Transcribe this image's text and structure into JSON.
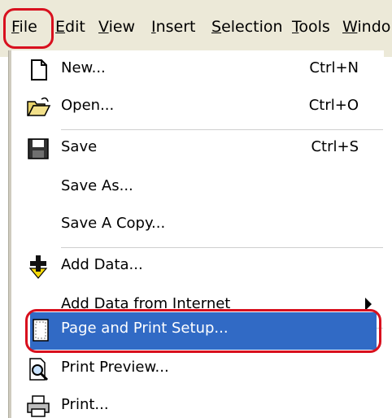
{
  "menubar": {
    "items": [
      {
        "label": "File",
        "mnemonic_index": 0
      },
      {
        "label": "Edit",
        "mnemonic_index": 0
      },
      {
        "label": "View",
        "mnemonic_index": 0
      },
      {
        "label": "Insert",
        "mnemonic_index": 0
      },
      {
        "label": "Selection",
        "mnemonic_index": 0
      },
      {
        "label": "Tools",
        "mnemonic_index": 0
      },
      {
        "label": "Windo",
        "mnemonic_index": 0
      }
    ]
  },
  "file_menu": {
    "items": [
      {
        "label": "New...",
        "shortcut": "Ctrl+N",
        "icon": "new-document-icon"
      },
      {
        "label": "Open...",
        "shortcut": "Ctrl+O",
        "icon": "open-folder-icon"
      },
      {
        "label": "Save",
        "shortcut": "Ctrl+S",
        "icon": "save-floppy-icon"
      },
      {
        "label": "Save As...",
        "shortcut": "",
        "icon": ""
      },
      {
        "label": "Save A Copy...",
        "shortcut": "",
        "icon": ""
      },
      {
        "label": "Add Data...",
        "shortcut": "",
        "icon": "add-data-icon"
      },
      {
        "label": "Add Data from Internet",
        "shortcut": "",
        "icon": "",
        "submenu": true
      },
      {
        "label": "Page and Print Setup...",
        "shortcut": "",
        "icon": "page-setup-icon",
        "selected": true
      },
      {
        "label": "Print Preview...",
        "shortcut": "",
        "icon": "print-preview-icon"
      },
      {
        "label": "Print...",
        "shortcut": "",
        "icon": "printer-icon"
      }
    ]
  },
  "colors": {
    "highlight": "#316ac5",
    "annotation_ring": "#d8101e",
    "menubar_bg": "#ece9d8"
  }
}
